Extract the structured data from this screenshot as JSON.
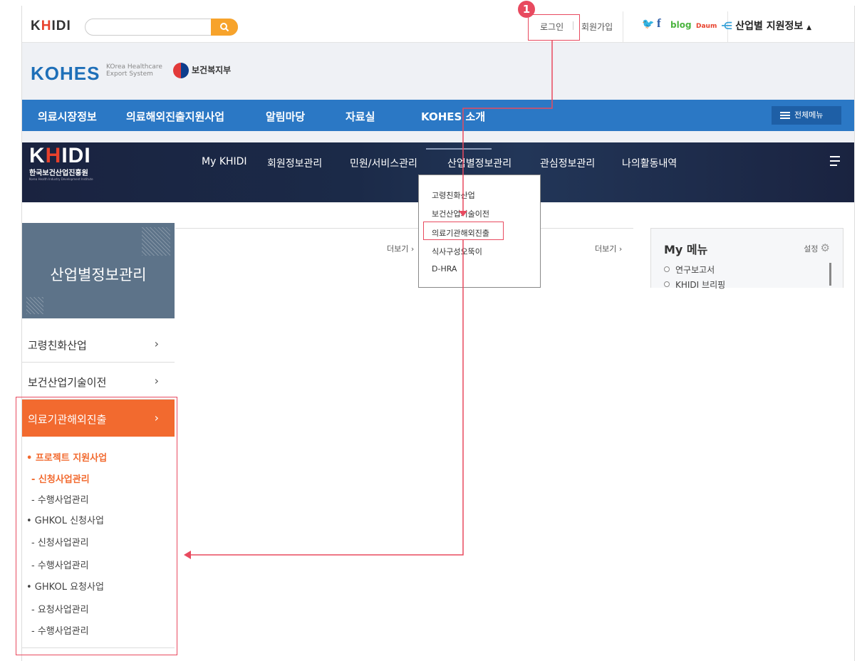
{
  "topbar": {
    "logo": "KHIDI",
    "search_placeholder": "",
    "login": "로그인",
    "join": "회원가입",
    "blog": "blog",
    "daum": "Daum",
    "industry_info": "산업별 지원정보"
  },
  "kohes": {
    "logo": "KOHES",
    "sub_line1": "KOrea Healthcare",
    "sub_line2": "Export System",
    "ministry": "보건복지부",
    "nav": [
      "의료시장정보",
      "의료해외진출지원사업",
      "알림마당",
      "자료실",
      "KOHES 소개"
    ],
    "all_menu": "전체메뉴"
  },
  "khidi": {
    "logo": "KHIDI",
    "name": "한국보건산업진흥원",
    "eng": "Korea Health Industry Development Institute",
    "nav": [
      "My KHIDI",
      "회원정보관리",
      "민원/서비스관리",
      "산업별정보관리",
      "관심정보관리",
      "나의활동내역"
    ]
  },
  "dropdown": {
    "items": [
      "고령친화산업",
      "보건산업기술이전",
      "의료기관해외진출",
      "식사구성오뚝이",
      "D-HRA"
    ]
  },
  "lnb": {
    "title": "산업별정보관리",
    "items": [
      "고령친화산업",
      "보건산업기술이전"
    ],
    "active": "의료기관해외진출",
    "subs": [
      {
        "text": "• 프로젝트 지원사업",
        "on": true
      },
      {
        "text": "- 신청사업관리",
        "on": true
      },
      {
        "text": "- 수행사업관리",
        "on": false
      },
      {
        "text": "• GHKOL 신청사업",
        "on": false
      },
      {
        "text": "- 신청사업관리",
        "on": false
      },
      {
        "text": "- 수행사업관리",
        "on": false
      },
      {
        "text": "• GHKOL 요청사업",
        "on": false
      },
      {
        "text": "- 요청사업관리",
        "on": false
      },
      {
        "text": "- 수행사업관리",
        "on": false
      }
    ]
  },
  "content": {
    "more1": "더보기 ›",
    "more2": "더보기 ›"
  },
  "mymenu": {
    "title": "My 메뉴",
    "setting": "설정",
    "items": [
      "연구보고서",
      "KHIDI 브리핑"
    ]
  },
  "annotation": {
    "step": "1",
    "color": "#e84a5f"
  }
}
